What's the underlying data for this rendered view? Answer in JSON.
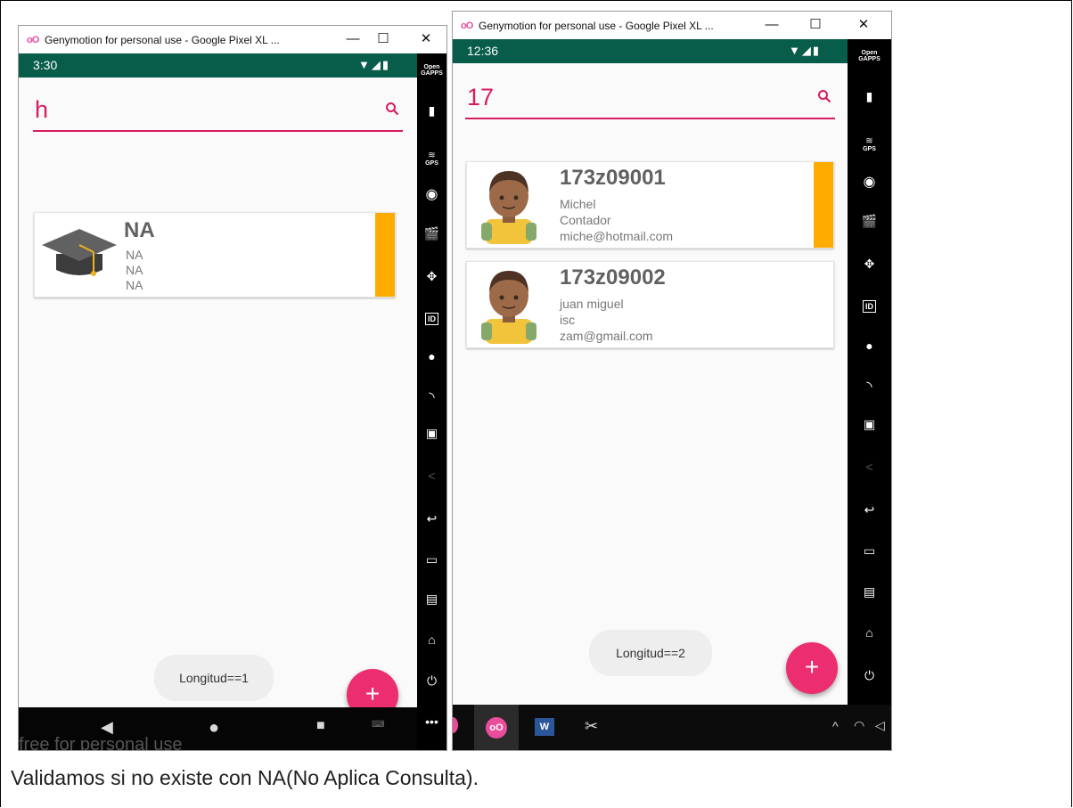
{
  "caption": "Validamos si no existe con NA(No Aplica Consulta).",
  "windows": [
    {
      "title": "Genymotion for personal use - Google Pixel XL ...",
      "time": "3:30",
      "search_value": "h",
      "toast": "Longitud==1",
      "fab": "+",
      "cards": [
        {
          "code": "NA",
          "name": "NA",
          "role": "NA",
          "email": "NA",
          "icon": "graduation-cap-icon"
        }
      ],
      "watermark": "free for personal use"
    },
    {
      "title": "Genymotion for personal use - Google Pixel XL ...",
      "time": "12:36",
      "search_value": "17",
      "toast": "Longitud==2",
      "fab": "+",
      "cards": [
        {
          "code": "173z09001",
          "name": "Michel",
          "role": "Contador",
          "email": "miche@hotmail.com",
          "icon": "avatar-icon"
        },
        {
          "code": "173z09002",
          "name": "juan miguel",
          "role": "isc",
          "email": "zam@gmail.com",
          "icon": "avatar-icon"
        }
      ]
    }
  ],
  "sidebar": {
    "open_gapps_line1": "Open",
    "open_gapps_line2": "GAPPS",
    "gps": "GPS",
    "id": "ID",
    "more": "•••"
  },
  "window_controls": {
    "minimize": "—",
    "maximize": "☐",
    "close": "✕"
  },
  "colors": {
    "accent": "#d81b60",
    "status_bar": "#075d4a",
    "stripe": "#ffab00",
    "fab": "#ec2d6f"
  }
}
